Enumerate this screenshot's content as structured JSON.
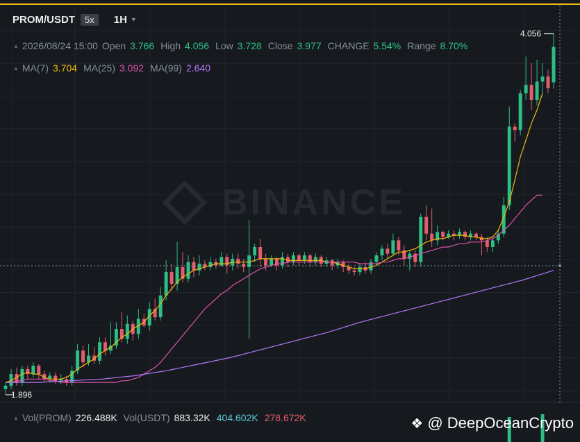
{
  "header": {
    "pair": "PROM/USDT",
    "leverage": "5x",
    "interval": "1H"
  },
  "ohlc": {
    "timestamp": "2026/08/24 15:00",
    "open_label": "Open",
    "open": "3.766",
    "high_label": "High",
    "high": "4.056",
    "low_label": "Low",
    "low": "3.728",
    "close_label": "Close",
    "close": "3.977",
    "change_label": "CHANGE",
    "change": "5.54%",
    "range_label": "Range",
    "range": "8.70%"
  },
  "ma": {
    "ma7_label": "MA(7)",
    "ma7": "3.704",
    "ma25_label": "MA(25)",
    "ma25": "3.092",
    "ma99_label": "MA(99)",
    "ma99": "2.640"
  },
  "volume": {
    "vol_prom_label": "Vol(PROM)",
    "vol_prom": "226.488K",
    "vol_usdt_label": "Vol(USDT)",
    "vol_usdt": "883.32K",
    "vol_buy": "404.602K",
    "vol_sell": "278.672K"
  },
  "watermark": "BINANCE",
  "attribution": "@ DeepOceanCrypto",
  "colors": {
    "up": "#2ebd85",
    "down": "#e35d6a",
    "ma7": "#f0b90b",
    "ma25": "#e04fb0",
    "ma99": "#b278ff",
    "accent": "#f0b90b",
    "background": "#161a1e"
  },
  "chart_data": {
    "type": "candlestick",
    "ylim": [
      1.85,
      4.15
    ],
    "max_label": "4.056",
    "min_label": "1.896",
    "series": [
      {
        "name": "PROM/USDT",
        "ohlc": [
          [
            1.93,
            1.95,
            1.896,
            1.97
          ],
          [
            1.95,
            2.02,
            1.93,
            2.05
          ],
          [
            2.02,
            1.97,
            1.95,
            2.06
          ],
          [
            1.97,
            2.05,
            1.95,
            2.07
          ],
          [
            2.05,
            2.02,
            1.99,
            2.07
          ],
          [
            2.02,
            2.07,
            2.0,
            2.09
          ],
          [
            2.07,
            2.02,
            1.99,
            2.08
          ],
          [
            2.02,
            1.99,
            1.97,
            2.04
          ],
          [
            1.99,
            2.01,
            1.97,
            2.03
          ],
          [
            2.01,
            1.98,
            1.96,
            2.03
          ],
          [
            1.98,
            1.99,
            1.96,
            2.02
          ],
          [
            1.99,
            1.97,
            1.95,
            2.01
          ],
          [
            1.97,
            2.04,
            1.95,
            2.07
          ],
          [
            2.04,
            2.16,
            2.02,
            2.2
          ],
          [
            2.16,
            2.09,
            2.06,
            2.19
          ],
          [
            2.09,
            2.13,
            2.07,
            2.2
          ],
          [
            2.13,
            2.1,
            2.08,
            2.18
          ],
          [
            2.1,
            2.21,
            2.08,
            2.24
          ],
          [
            2.21,
            2.16,
            2.13,
            2.24
          ],
          [
            2.16,
            2.19,
            2.14,
            2.33
          ],
          [
            2.19,
            2.29,
            2.17,
            2.33
          ],
          [
            2.29,
            2.23,
            2.21,
            2.39
          ],
          [
            2.23,
            2.32,
            2.2,
            2.37
          ],
          [
            2.32,
            2.26,
            2.22,
            2.34
          ],
          [
            2.26,
            2.35,
            2.23,
            2.41
          ],
          [
            2.35,
            2.31,
            2.3,
            2.38
          ],
          [
            2.31,
            2.41,
            2.28,
            2.45
          ],
          [
            2.41,
            2.36,
            2.34,
            2.47
          ],
          [
            2.36,
            2.49,
            2.34,
            2.54
          ],
          [
            2.49,
            2.63,
            2.46,
            2.7
          ],
          [
            2.63,
            2.56,
            2.52,
            2.68
          ],
          [
            2.56,
            2.66,
            2.52,
            2.81
          ],
          [
            2.66,
            2.59,
            2.57,
            2.75
          ],
          [
            2.59,
            2.69,
            2.57,
            2.73
          ],
          [
            2.69,
            2.64,
            2.6,
            2.72
          ],
          [
            2.64,
            2.68,
            2.61,
            2.73
          ],
          [
            2.68,
            2.66,
            2.64,
            2.7
          ],
          [
            2.66,
            2.69,
            2.64,
            2.72
          ],
          [
            2.69,
            2.67,
            2.65,
            2.71
          ],
          [
            2.67,
            2.72,
            2.66,
            2.75
          ],
          [
            2.72,
            2.67,
            2.62,
            2.74
          ],
          [
            2.67,
            2.71,
            2.64,
            2.74
          ],
          [
            2.71,
            2.68,
            2.65,
            2.74
          ],
          [
            2.68,
            2.66,
            2.63,
            2.71
          ],
          [
            2.66,
            2.73,
            2.23,
            2.94
          ],
          [
            2.73,
            2.78,
            2.69,
            2.8
          ],
          [
            2.78,
            2.71,
            2.66,
            2.83
          ],
          [
            2.71,
            2.67,
            2.64,
            2.74
          ],
          [
            2.67,
            2.71,
            2.66,
            2.73
          ],
          [
            2.71,
            2.67,
            2.64,
            2.72
          ],
          [
            2.67,
            2.72,
            2.65,
            2.75
          ],
          [
            2.72,
            2.69,
            2.66,
            2.74
          ],
          [
            2.69,
            2.73,
            2.67,
            2.75
          ],
          [
            2.73,
            2.7,
            2.67,
            2.74
          ],
          [
            2.7,
            2.73,
            2.68,
            2.75
          ],
          [
            2.73,
            2.69,
            2.66,
            2.74
          ],
          [
            2.69,
            2.72,
            2.67,
            2.74
          ],
          [
            2.72,
            2.68,
            2.66,
            2.73
          ],
          [
            2.68,
            2.7,
            2.66,
            2.72
          ],
          [
            2.7,
            2.67,
            2.64,
            2.71
          ],
          [
            2.67,
            2.69,
            2.65,
            2.71
          ],
          [
            2.69,
            2.66,
            2.63,
            2.7
          ],
          [
            2.66,
            2.64,
            2.62,
            2.68
          ],
          [
            2.64,
            2.63,
            2.61,
            2.66
          ],
          [
            2.63,
            2.66,
            2.61,
            2.68
          ],
          [
            2.66,
            2.64,
            2.62,
            2.69
          ],
          [
            2.64,
            2.69,
            2.62,
            2.71
          ],
          [
            2.69,
            2.73,
            2.67,
            2.75
          ],
          [
            2.73,
            2.77,
            2.7,
            2.79
          ],
          [
            2.77,
            2.74,
            2.71,
            2.8
          ],
          [
            2.74,
            2.82,
            2.73,
            2.86
          ],
          [
            2.82,
            2.76,
            2.73,
            2.84
          ],
          [
            2.76,
            2.71,
            2.67,
            2.79
          ],
          [
            2.71,
            2.74,
            2.64,
            2.76
          ],
          [
            2.74,
            2.69,
            2.66,
            2.76
          ],
          [
            2.69,
            2.96,
            2.66,
            2.98
          ],
          [
            2.96,
            2.86,
            2.82,
            3.03
          ],
          [
            2.86,
            2.82,
            2.78,
            3.01
          ],
          [
            2.82,
            2.87,
            2.79,
            2.91
          ],
          [
            2.87,
            2.84,
            2.82,
            2.88
          ],
          [
            2.84,
            2.86,
            2.83,
            2.88
          ],
          [
            2.86,
            2.85,
            2.82,
            2.88
          ],
          [
            2.85,
            2.87,
            2.83,
            2.89
          ],
          [
            2.87,
            2.84,
            2.82,
            2.88
          ],
          [
            2.84,
            2.86,
            2.82,
            2.88
          ],
          [
            2.86,
            2.84,
            2.82,
            2.87
          ],
          [
            2.84,
            2.82,
            2.73,
            2.86
          ],
          [
            2.82,
            2.78,
            2.75,
            2.84
          ],
          [
            2.78,
            2.82,
            2.75,
            2.84
          ],
          [
            2.82,
            2.86,
            2.8,
            2.88
          ],
          [
            2.86,
            3.03,
            2.84,
            3.08
          ],
          [
            3.03,
            3.5,
            3.0,
            3.62
          ],
          [
            3.5,
            3.48,
            3.41,
            3.52
          ],
          [
            3.48,
            3.7,
            3.45,
            3.72
          ],
          [
            3.7,
            3.75,
            3.66,
            3.92
          ],
          [
            3.75,
            3.66,
            3.6,
            3.88
          ],
          [
            3.66,
            3.77,
            3.63,
            3.9
          ],
          [
            3.77,
            3.8,
            3.7,
            3.88
          ],
          [
            3.8,
            3.73,
            3.7,
            3.84
          ],
          [
            3.766,
            3.977,
            3.728,
            4.056
          ]
        ]
      },
      {
        "name": "MA(7)",
        "values": [
          1.97,
          1.98,
          2.0,
          2.02,
          2.03,
          2.02,
          2.02,
          2.0,
          1.99,
          1.99,
          1.99,
          2.0,
          2.02,
          2.05,
          2.07,
          2.09,
          2.11,
          2.14,
          2.16,
          2.18,
          2.21,
          2.24,
          2.26,
          2.29,
          2.31,
          2.33,
          2.37,
          2.4,
          2.44,
          2.49,
          2.53,
          2.57,
          2.6,
          2.62,
          2.64,
          2.65,
          2.66,
          2.67,
          2.68,
          2.68,
          2.68,
          2.69,
          2.69,
          2.69,
          2.69,
          2.7,
          2.71,
          2.71,
          2.71,
          2.71,
          2.71,
          2.7,
          2.7,
          2.7,
          2.7,
          2.7,
          2.7,
          2.7,
          2.69,
          2.69,
          2.68,
          2.67,
          2.66,
          2.65,
          2.65,
          2.65,
          2.66,
          2.67,
          2.69,
          2.71,
          2.73,
          2.75,
          2.75,
          2.76,
          2.77,
          2.79,
          2.81,
          2.82,
          2.83,
          2.83,
          2.84,
          2.85,
          2.85,
          2.85,
          2.84,
          2.84,
          2.83,
          2.83,
          2.84,
          2.88,
          2.96,
          3.05,
          3.18,
          3.32,
          3.42,
          3.52,
          3.6,
          3.7
        ]
      },
      {
        "name": "MA(25)",
        "values": [
          null,
          null,
          null,
          null,
          null,
          null,
          null,
          null,
          null,
          null,
          null,
          null,
          null,
          null,
          null,
          null,
          null,
          null,
          null,
          null,
          1.97,
          1.98,
          1.98,
          1.99,
          2.0,
          2.02,
          2.04,
          2.06,
          2.09,
          2.13,
          2.17,
          2.21,
          2.25,
          2.29,
          2.33,
          2.37,
          2.41,
          2.44,
          2.47,
          2.5,
          2.52,
          2.55,
          2.57,
          2.59,
          2.61,
          2.63,
          2.65,
          2.66,
          2.67,
          2.68,
          2.68,
          2.69,
          2.69,
          2.69,
          2.69,
          2.69,
          2.69,
          2.69,
          2.69,
          2.69,
          2.69,
          2.69,
          2.69,
          2.69,
          2.68,
          2.68,
          2.68,
          2.68,
          2.69,
          2.69,
          2.7,
          2.71,
          2.71,
          2.72,
          2.73,
          2.74,
          2.75,
          2.76,
          2.77,
          2.78,
          2.78,
          2.79,
          2.8,
          2.8,
          2.81,
          2.81,
          2.81,
          2.82,
          2.83,
          2.85,
          2.88,
          2.91,
          2.95,
          2.99,
          3.03,
          3.06,
          3.09,
          3.09
        ]
      },
      {
        "name": "MA(99)",
        "values": [
          null,
          null,
          null,
          null,
          null,
          null,
          null,
          null,
          null,
          null,
          null,
          null,
          null,
          null,
          null,
          null,
          null,
          null,
          null,
          null,
          null,
          null,
          null,
          null,
          null,
          null,
          null,
          null,
          null,
          null,
          null,
          null,
          null,
          null,
          null,
          null,
          null,
          null,
          null,
          null,
          null,
          null,
          null,
          null,
          null,
          null,
          null,
          null,
          null,
          null,
          null,
          null,
          null,
          null,
          null,
          null,
          null,
          null,
          null,
          null,
          null,
          null,
          null,
          null,
          null,
          null,
          null,
          null,
          null,
          null,
          null,
          null,
          null,
          null,
          null,
          null,
          null,
          null,
          null,
          null,
          null,
          null,
          null,
          null,
          null,
          null,
          null,
          null,
          null,
          null,
          null,
          null,
          null,
          null,
          null,
          null,
          null,
          2.64
        ],
        "history": [
          1.97,
          1.97,
          1.98,
          1.99,
          2.01,
          2.04,
          2.08,
          2.12,
          2.17,
          2.22,
          2.27,
          2.33,
          2.38,
          2.43,
          2.48,
          2.53,
          2.58,
          2.64
        ]
      }
    ],
    "volume_bars": [
      {
        "index": 91,
        "value": 0.9
      },
      {
        "index": 97,
        "value": 1.0
      }
    ]
  }
}
